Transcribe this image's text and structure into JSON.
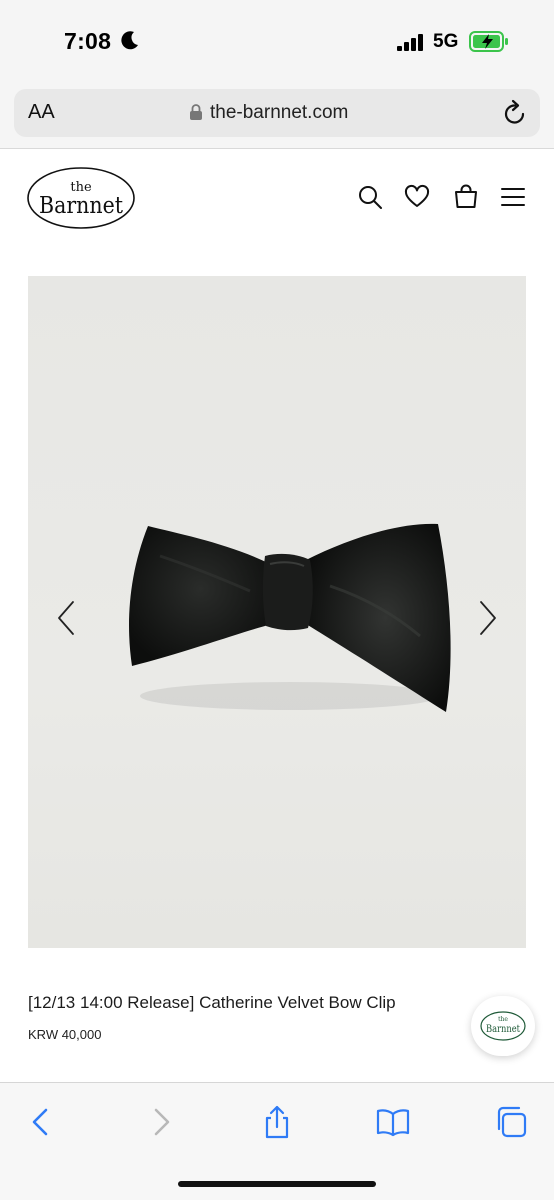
{
  "status": {
    "time": "7:08",
    "network": "5G"
  },
  "browser": {
    "text_size_label": "AA",
    "url": "the-barnnet.com"
  },
  "site": {
    "logo_small": "the",
    "logo_big": "Barnnet"
  },
  "product": {
    "title": "[12/13 14:00 Release] Catherine Velvet Bow Clip",
    "price": "KRW 40,000"
  },
  "colors": {
    "accent_badge": "#1f5a38",
    "battery": "#3bc44b",
    "safari_blue": "#2f7bf6"
  }
}
